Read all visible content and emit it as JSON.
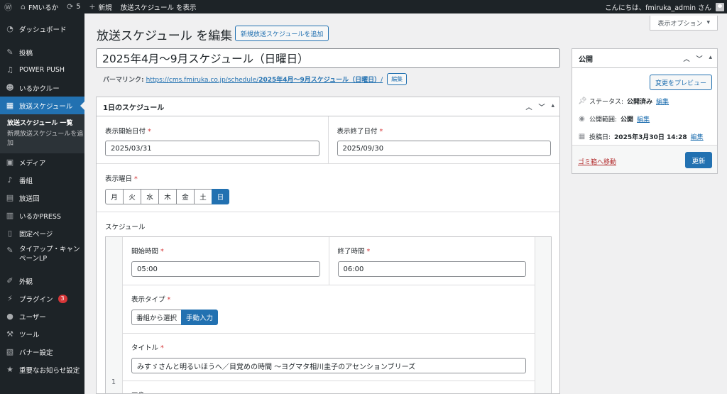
{
  "adminbar": {
    "site_name": "FMいるか",
    "updates_count": "5",
    "new_label": "新規",
    "view_label": "放送スケジュール を表示",
    "greeting": "こんにちは、fmiruka_admin さん"
  },
  "sidebar": {
    "items": [
      {
        "label": "ダッシュボード",
        "icon": "dashboard-icon"
      },
      {
        "label": "投稿",
        "icon": "pin-icon"
      },
      {
        "label": "POWER PUSH",
        "icon": "music-icon"
      },
      {
        "label": "いるかクルー",
        "icon": "users-icon"
      },
      {
        "label": "放送スケジュール",
        "icon": "calendar-icon"
      },
      {
        "label": "メディア",
        "icon": "media-icon"
      },
      {
        "label": "番組",
        "icon": "microphone-icon"
      },
      {
        "label": "放送回",
        "icon": "episode-icon"
      },
      {
        "label": "いるかPRESS",
        "icon": "press-icon"
      },
      {
        "label": "固定ページ",
        "icon": "page-icon"
      },
      {
        "label": "タイアップ・キャンペーンLP",
        "icon": "pin-icon"
      },
      {
        "label": "外観",
        "icon": "brush-icon"
      },
      {
        "label": "プラグイン",
        "icon": "plugin-icon",
        "badge": "3"
      },
      {
        "label": "ユーザー",
        "icon": "user-icon"
      },
      {
        "label": "ツール",
        "icon": "wrench-icon"
      },
      {
        "label": "バナー設定",
        "icon": "banner-icon"
      },
      {
        "label": "重要なお知らせ設定",
        "icon": "star-icon"
      }
    ],
    "submenu": {
      "list": "放送スケジュール 一覧",
      "add": "新規放送スケジュールを追加"
    }
  },
  "screen_options": "表示オプション",
  "page": {
    "title": "放送スケジュール を編集",
    "add_new": "新規放送スケジュールを追加",
    "post_title": "2025年4月〜9月スケジュール（日曜日）",
    "permalink_label": "パーマリンク:",
    "permalink_base": "https://cms.fmiruka.co.jp/schedule/",
    "permalink_slug": "2025年4月〜9月スケジュール（日曜日）",
    "permalink_tail": "/",
    "edit_label": "編集"
  },
  "metabox": {
    "title": "1日のスケジュール",
    "start_date_label": "表示開始日付",
    "start_date": "2025/03/31",
    "end_date_label": "表示終了日付",
    "end_date": "2025/09/30",
    "day_label": "表示曜日",
    "days": [
      "月",
      "火",
      "水",
      "木",
      "金",
      "土",
      "日"
    ],
    "day_selected_index": 6,
    "schedule_label": "スケジュール",
    "row_number": "1",
    "start_time_label": "開始時間",
    "start_time": "05:00",
    "end_time_label": "終了時間",
    "end_time": "06:00",
    "type_label": "表示タイプ",
    "type_options": [
      "番組から選択",
      "手動入力"
    ],
    "type_selected_index": 1,
    "title_label": "タイトル",
    "title_value": "みすゞさんと明るいほうへ／目覚めの時間 〜ヨグマタ相川圭子のアセンションブリーズ",
    "image_label": "画像",
    "required_mark": "*"
  },
  "publish": {
    "title": "公開",
    "preview_button": "変更をプレビュー",
    "status_label": "ステータス:",
    "status_value": "公開済み",
    "visibility_label": "公開範囲:",
    "visibility_value": "公開",
    "date_label": "投稿日:",
    "date_value": "2025年3月30日 14:28",
    "edit_label": "編集",
    "trash_label": "ゴミ箱へ移動",
    "update_button": "更新"
  },
  "colors": {
    "accent": "#2271b1",
    "adminbar": "#1d2327",
    "danger": "#d63638"
  }
}
